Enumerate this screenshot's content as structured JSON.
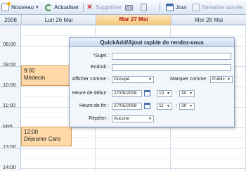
{
  "toolbar": {
    "new_label": "Nouveau",
    "refresh_label": "Actualiser",
    "delete_label": "Supprimer",
    "day_label": "Jour",
    "week_label": "Semaine ouvrée"
  },
  "header": {
    "year": "2008",
    "days": [
      "Lun 26 Mai",
      "Mar 27 Mai",
      "Mer 28 Mai"
    ],
    "today_index": 1
  },
  "times": [
    "08:00",
    "09:00",
    "10:00",
    "11:00",
    "Midi",
    "13:00",
    "14:00"
  ],
  "appointments": [
    {
      "time": "9:00",
      "title": "Médecin"
    },
    {
      "time": "12:00",
      "title": "Déjeuner Caro"
    }
  ],
  "dialog": {
    "title": "QuickAdd/Ajout rapide de rendez-vous",
    "subject_label": "*Sujet :",
    "location_label": "Endroit :",
    "show_as_label": "Afficher comme :",
    "show_as_value": "Occupé",
    "mark_as_label": "Marquer comme :",
    "mark_as_value": "Public",
    "start_label": "Heure de début :",
    "start_date": "27/05/2008",
    "start_hour": "10",
    "start_min": "30",
    "end_label": "Heure de fin :",
    "end_date": "27/05/2008",
    "end_hour": "11",
    "end_min": "30",
    "repeat_label": "Répéter :",
    "repeat_value": "Aucune"
  },
  "colors": {
    "today_header": "#f4c97d",
    "appointment": "#ffd9a8",
    "accent": "#3f6fa8"
  }
}
